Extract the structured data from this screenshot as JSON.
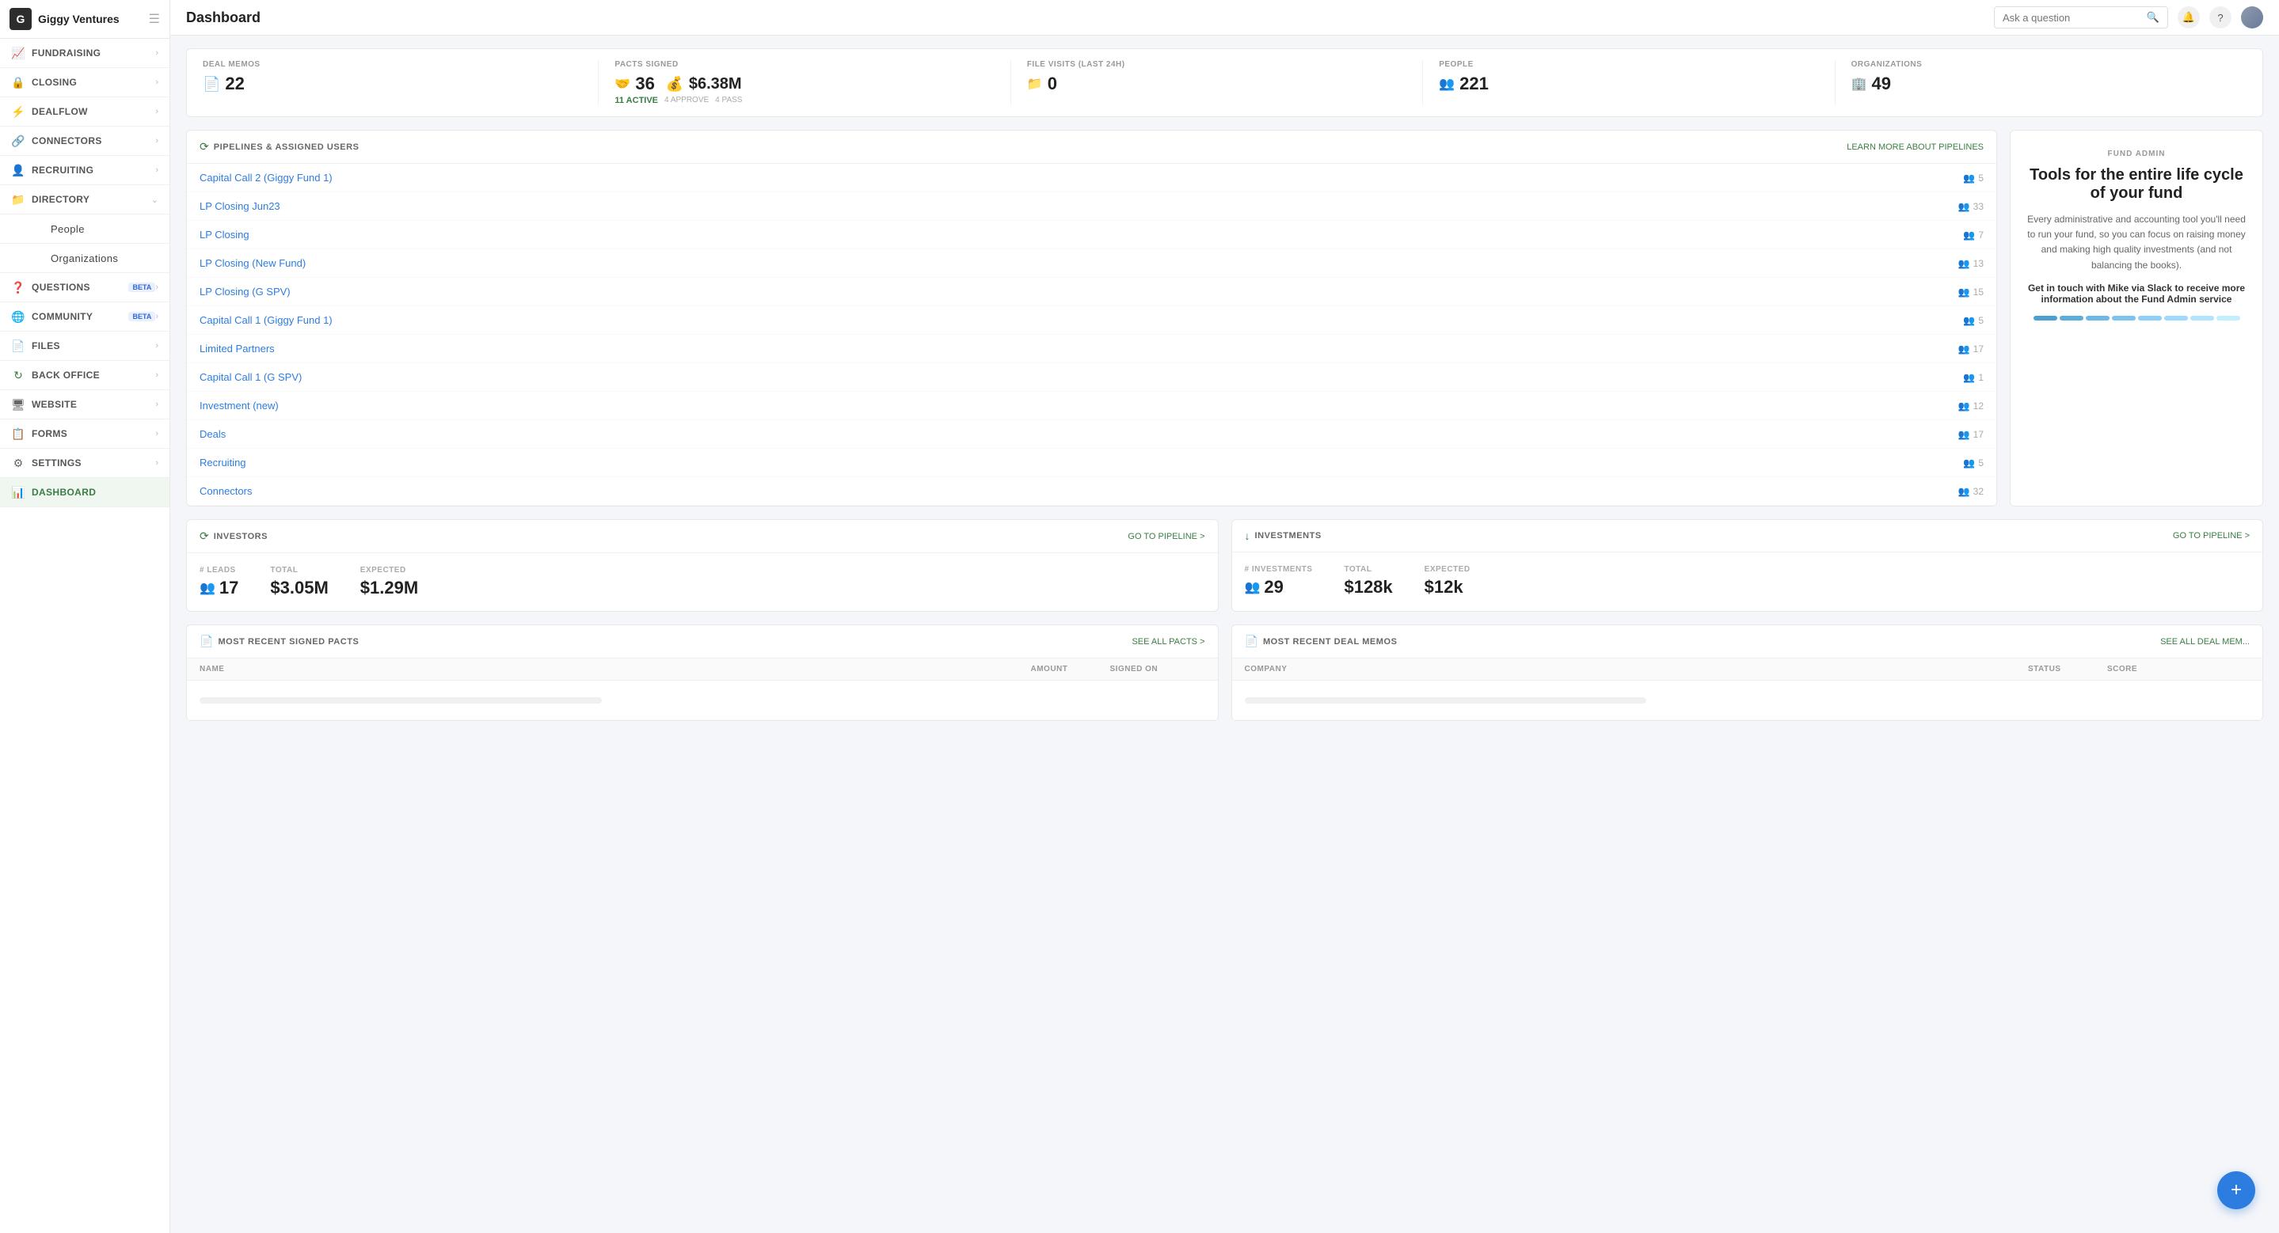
{
  "app": {
    "logo_letter": "G",
    "name": "Giggy Ventures"
  },
  "topbar": {
    "title": "Dashboard",
    "search_placeholder": "Ask a question"
  },
  "sidebar": {
    "items": [
      {
        "id": "fundraising",
        "label": "FUNDRAISING",
        "icon": "📈",
        "has_chevron": true,
        "active": false
      },
      {
        "id": "closing",
        "label": "CLOSING",
        "icon": "🔒",
        "has_chevron": true,
        "active": false
      },
      {
        "id": "dealflow",
        "label": "DEALFLOW",
        "icon": "⚡",
        "has_chevron": true,
        "active": false
      },
      {
        "id": "connectors",
        "label": "CONNECTORS",
        "icon": "🔗",
        "has_chevron": true,
        "active": false
      },
      {
        "id": "recruiting",
        "label": "RECRUITING",
        "icon": "👤",
        "has_chevron": true,
        "active": false
      },
      {
        "id": "directory",
        "label": "DIRECTORY",
        "icon": "📁",
        "has_chevron": true,
        "active": false,
        "expanded": true
      },
      {
        "id": "people",
        "label": "People",
        "icon": "",
        "has_chevron": false,
        "sub": true
      },
      {
        "id": "organizations",
        "label": "Organizations",
        "icon": "",
        "has_chevron": false,
        "sub": true
      },
      {
        "id": "questions",
        "label": "QUESTIONS",
        "icon": "❓",
        "has_chevron": true,
        "badge": "BETA",
        "active": false
      },
      {
        "id": "community",
        "label": "COMMUNITY",
        "icon": "🌐",
        "has_chevron": true,
        "badge": "BETA",
        "active": false
      },
      {
        "id": "files",
        "label": "FILES",
        "icon": "📄",
        "has_chevron": true,
        "active": false
      },
      {
        "id": "back_office",
        "label": "BACK OFFICE",
        "icon": "🔄",
        "has_chevron": true,
        "active": false
      },
      {
        "id": "website",
        "label": "WEBSITE",
        "icon": "🖥",
        "has_chevron": true,
        "active": false
      },
      {
        "id": "forms",
        "label": "FORMS",
        "icon": "📋",
        "has_chevron": true,
        "active": false
      },
      {
        "id": "settings",
        "label": "SETTINGS",
        "icon": "⚙",
        "has_chevron": true,
        "active": false
      },
      {
        "id": "dashboard",
        "label": "DASHBOARD",
        "icon": "📊",
        "has_chevron": false,
        "active": true
      }
    ]
  },
  "stats": [
    {
      "id": "deal-memos",
      "label": "DEAL MEMOS",
      "value": "22",
      "icon": "📄",
      "sub": ""
    },
    {
      "id": "pacts-signed",
      "label": "PACTS SIGNED",
      "value": "36",
      "value2": "$6.38M",
      "icon": "🤝",
      "icon2": "💰",
      "active_count": "11 ACTIVE",
      "approve": "4 APPROVE",
      "pass": "4 PASS"
    },
    {
      "id": "file-visits",
      "label": "FILE VISITS (last 24h)",
      "value": "0",
      "icon": "📁"
    },
    {
      "id": "people",
      "label": "PEOPLE",
      "value": "221",
      "icon": "👥"
    },
    {
      "id": "organizations",
      "label": "ORGANIZATIONS",
      "value": "49",
      "icon": "🏢"
    }
  ],
  "pipelines": {
    "section_title": "PIPELINES & ASSIGNED USERS",
    "learn_more": "LEARN MORE ABOUT PIPELINES",
    "items": [
      {
        "name": "Capital Call 2 (Giggy Fund 1)",
        "users": 5
      },
      {
        "name": "LP Closing Jun23",
        "users": 33
      },
      {
        "name": "LP Closing",
        "users": 7
      },
      {
        "name": "LP Closing (New Fund)",
        "users": 13
      },
      {
        "name": "LP Closing (G SPV)",
        "users": 15
      },
      {
        "name": "Capital Call 1 (Giggy Fund 1)",
        "users": 5
      },
      {
        "name": "Limited Partners",
        "users": 17
      },
      {
        "name": "Capital Call 1 (G SPV)",
        "users": 1
      },
      {
        "name": "Investment (new)",
        "users": 12
      },
      {
        "name": "Deals",
        "users": 17
      },
      {
        "name": "Recruiting",
        "users": 5
      },
      {
        "name": "Connectors",
        "users": 32
      }
    ]
  },
  "fund_admin": {
    "label": "FUND ADMIN",
    "title": "Tools for the entire life cycle of your fund",
    "desc": "Every administrative and accounting tool you'll need to run your fund, so you can focus on raising money and making high quality investments (and not balancing the books).",
    "cta": "Get in touch with Mike via Slack to receive more information about the Fund Admin service",
    "bars": [
      {
        "color": "#4a9fd4"
      },
      {
        "color": "#5badde"
      },
      {
        "color": "#6cb8e8"
      },
      {
        "color": "#7dc3f0"
      },
      {
        "color": "#8ecef8"
      },
      {
        "color": "#9fd9ff"
      },
      {
        "color": "#b0e4ff"
      },
      {
        "color": "#c1efff"
      }
    ]
  },
  "investors": {
    "section_title": "INVESTORS",
    "link": "GO TO PIPELINE >",
    "leads_label": "# LEADS",
    "leads_value": "17",
    "total_label": "TOTAL",
    "total_value": "$3.05M",
    "expected_label": "EXPECTED",
    "expected_value": "$1.29M"
  },
  "investments": {
    "section_title": "INVESTMENTS",
    "link": "GO TO PIPELINE >",
    "count_label": "# INVESTMENTS",
    "count_value": "29",
    "total_label": "TOTAL",
    "total_value": "$128k",
    "expected_label": "EXPECTED",
    "expected_value": "$12k"
  },
  "pacts": {
    "section_title": "MOST RECENT SIGNED PACTS",
    "link": "SEE ALL PACTS >",
    "col_name": "NAME",
    "col_amount": "AMOUNT",
    "col_signed": "SIGNED ON"
  },
  "deal_memos": {
    "section_title": "MOST RECENT DEAL MEMOS",
    "link": "SEE ALL DEAL MEM...",
    "col_company": "COMPANY",
    "col_status": "STATUS",
    "col_score": "SCORE"
  },
  "fab": {
    "label": "+"
  }
}
